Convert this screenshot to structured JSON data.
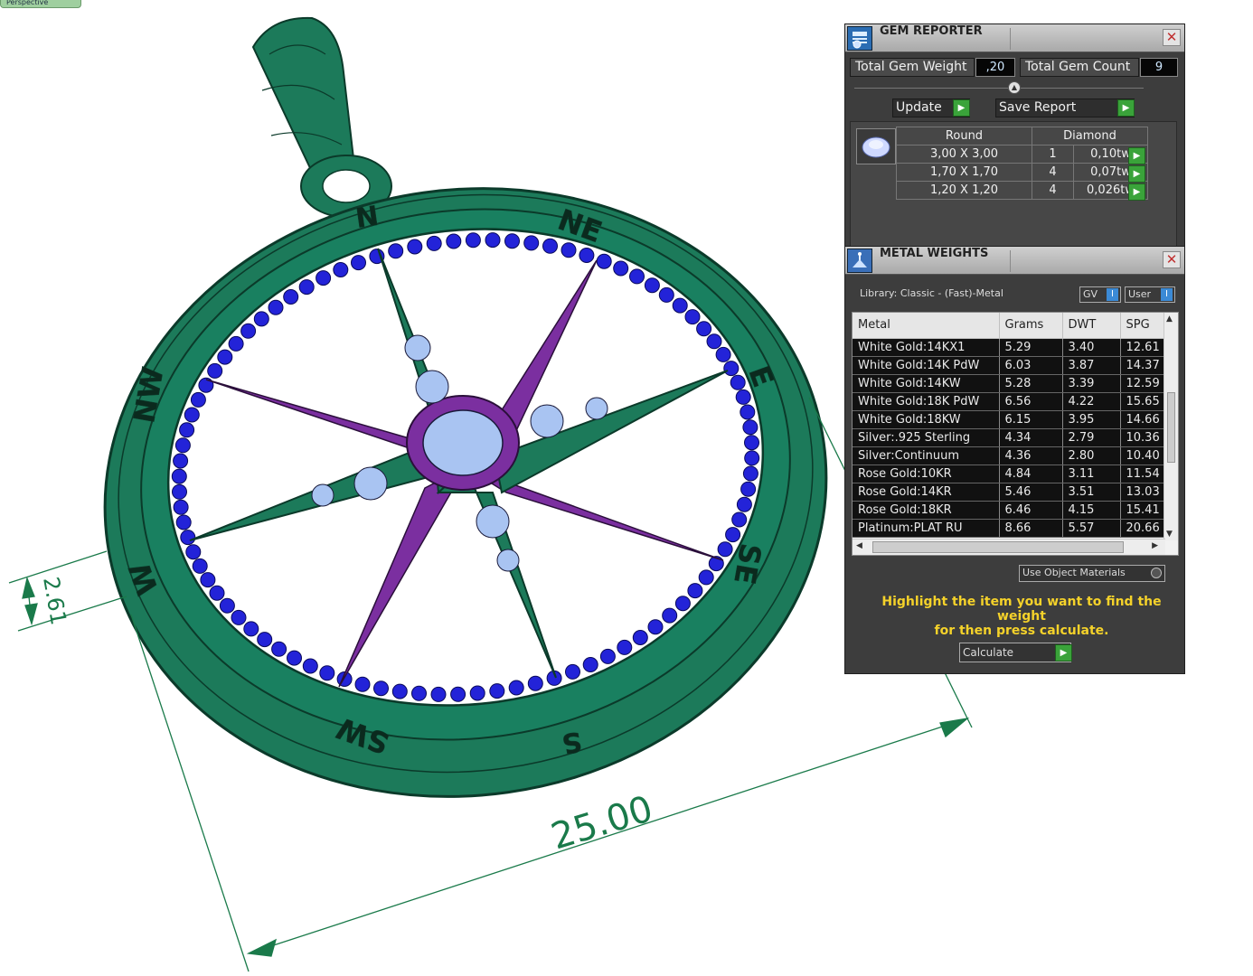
{
  "viewport": {
    "tab_label": "Perspective",
    "compass_letters": [
      "N",
      "NE",
      "E",
      "SE",
      "S",
      "SW",
      "W",
      "NW"
    ],
    "dimension_total": "25.00",
    "dimension_rim": "2.61",
    "colors": {
      "metal": "#1c7a5a",
      "stones_rim": "#2323d8",
      "star_rays": "#7b2fa0",
      "gems": "#a9c4f2",
      "dimension": "#1a7a4a"
    }
  },
  "gem_reporter": {
    "title": "GEM REPORTER",
    "close_icon": "close-icon",
    "total_weight_label": "Total Gem Weight",
    "total_weight_value": ",20",
    "total_count_label": "Total Gem Count",
    "total_count_value": "9",
    "update_label": "Update",
    "save_report_label": "Save Report",
    "table": {
      "col_shape": "Round",
      "col_material": "Diamond",
      "rows": [
        {
          "size": "3,00 X 3,00",
          "count": "1",
          "weight": "0,10tw"
        },
        {
          "size": "1,70 X 1,70",
          "count": "4",
          "weight": "0,07tw"
        },
        {
          "size": "1,20 X 1,20",
          "count": "4",
          "weight": "0,026tw"
        }
      ]
    }
  },
  "metal_weights": {
    "title": "METAL WEIGHTS",
    "library_label": "Library: Classic - (Fast)-Metal",
    "gv_label": "GV",
    "user_label": "User",
    "columns": [
      "Metal",
      "Grams",
      "DWT",
      "SPG"
    ],
    "rows": [
      {
        "metal": "White Gold:14KX1",
        "grams": "5.29",
        "dwt": "3.40",
        "spg": "12.61"
      },
      {
        "metal": "White Gold:14K PdW",
        "grams": "6.03",
        "dwt": "3.87",
        "spg": "14.37"
      },
      {
        "metal": "White Gold:14KW",
        "grams": "5.28",
        "dwt": "3.39",
        "spg": "12.59"
      },
      {
        "metal": "White Gold:18K PdW",
        "grams": "6.56",
        "dwt": "4.22",
        "spg": "15.65"
      },
      {
        "metal": "White Gold:18KW",
        "grams": "6.15",
        "dwt": "3.95",
        "spg": "14.66"
      },
      {
        "metal": "Silver:.925 Sterling",
        "grams": "4.34",
        "dwt": "2.79",
        "spg": "10.36"
      },
      {
        "metal": "Silver:Continuum",
        "grams": "4.36",
        "dwt": "2.80",
        "spg": "10.40"
      },
      {
        "metal": "Rose Gold:10KR",
        "grams": "4.84",
        "dwt": "3.11",
        "spg": "11.54"
      },
      {
        "metal": "Rose Gold:14KR",
        "grams": "5.46",
        "dwt": "3.51",
        "spg": "13.03"
      },
      {
        "metal": "Rose Gold:18KR",
        "grams": "6.46",
        "dwt": "4.15",
        "spg": "15.41"
      },
      {
        "metal": "Platinum:PLAT RU",
        "grams": "8.66",
        "dwt": "5.57",
        "spg": "20.66"
      }
    ],
    "use_object_materials_label": "Use Object Materials",
    "hint_line1": "Highlight the item you want to find the weight",
    "hint_line2": "for then press calculate.",
    "calculate_label": "Calculate"
  }
}
